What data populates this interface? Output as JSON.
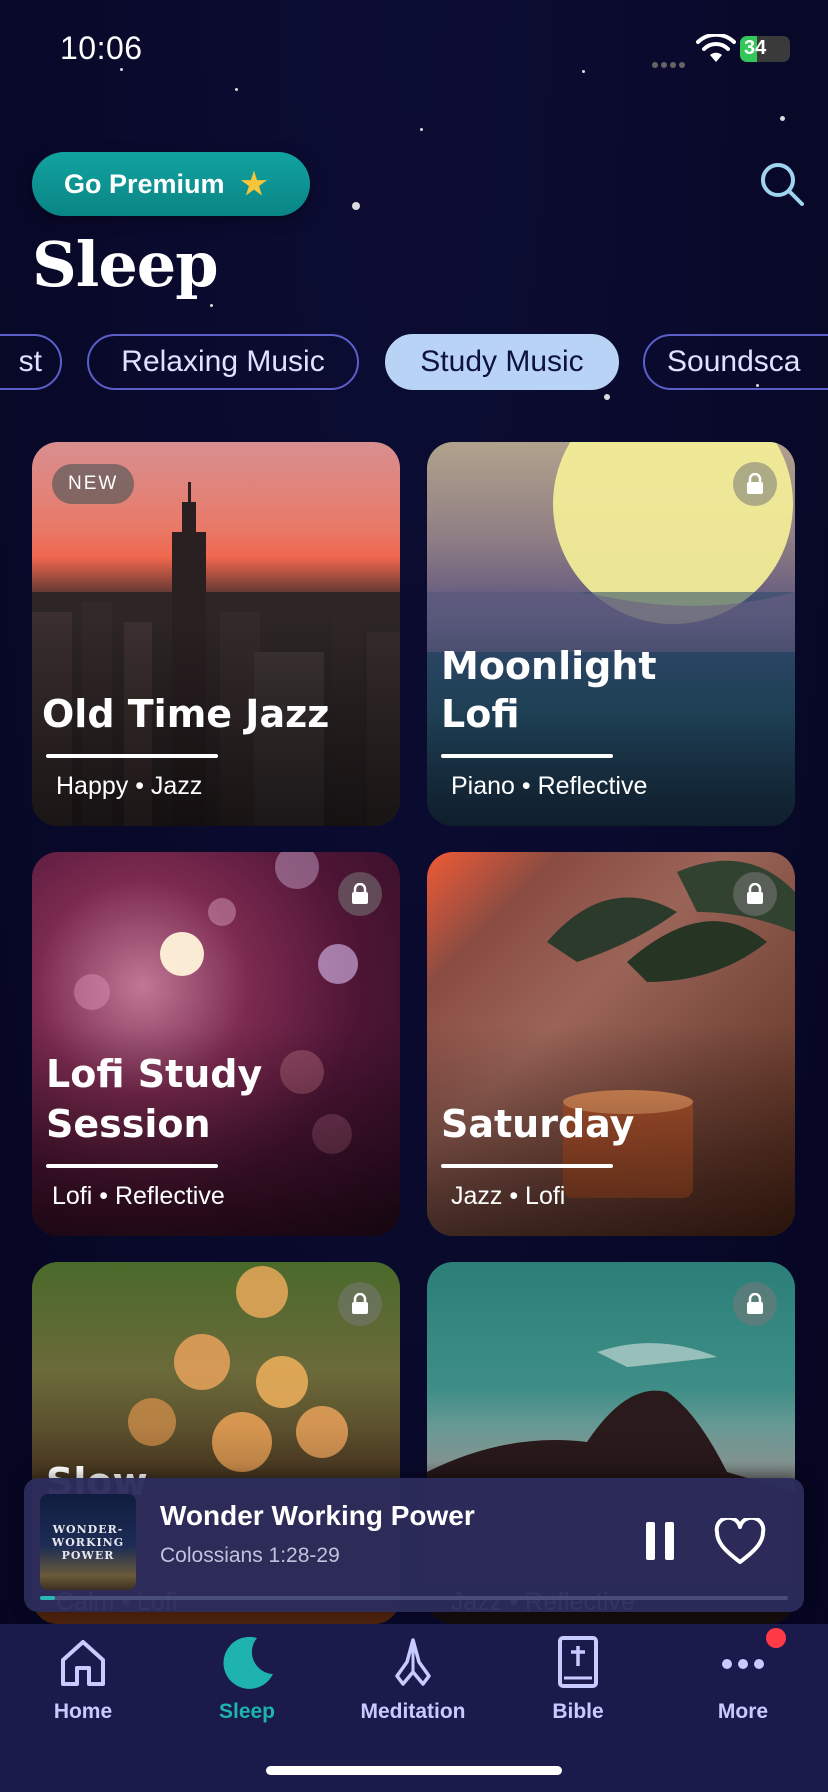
{
  "status": {
    "time": "10:06",
    "battery": "34",
    "battery_level": 0.34
  },
  "header": {
    "premium_label": "Go Premium",
    "page_title": "Sleep"
  },
  "chips": [
    {
      "label": "st"
    },
    {
      "label": "Relaxing Music"
    },
    {
      "label": "Study Music"
    },
    {
      "label": "Soundsca"
    }
  ],
  "active_chip": "Study Music",
  "cards": [
    {
      "title_line1": "Old Time Jazz",
      "title_line2": "",
      "tags": "Happy • Jazz",
      "badge": "NEW",
      "locked": false
    },
    {
      "title_line1": "Moonlight",
      "title_line2": "Lofi",
      "tags": "Piano • Reflective",
      "badge": "",
      "locked": true
    },
    {
      "title_line1": "Lofi Study",
      "title_line2": "Session",
      "tags": "Lofi • Reflective",
      "badge": "",
      "locked": true
    },
    {
      "title_line1": "Saturday",
      "title_line2": "",
      "tags": "Jazz • Lofi",
      "badge": "",
      "locked": true
    },
    {
      "title_line1": "Slow",
      "title_line2": "",
      "tags": "Calm • Lofi",
      "badge": "",
      "locked": true
    },
    {
      "title_line1": "",
      "title_line2": "",
      "tags": "Jazz • Reflective",
      "badge": "",
      "locked": true
    }
  ],
  "player": {
    "title": "Wonder Working Power",
    "subtitle": "Colossians 1:28-29",
    "art_text": [
      "WONDER-",
      "WORKING",
      "POWER"
    ],
    "progress": 0.02
  },
  "tabs": [
    {
      "label": "Home",
      "icon": "house-icon"
    },
    {
      "label": "Sleep",
      "icon": "moon-icon"
    },
    {
      "label": "Meditation",
      "icon": "praying-hands-icon"
    },
    {
      "label": "Bible",
      "icon": "bible-icon"
    },
    {
      "label": "More",
      "icon": "more-dots-icon"
    }
  ],
  "colors": {
    "accent": "#1fb3ad",
    "premium": "#0f9b98",
    "chip_active": "#b9d3f6",
    "background": "#0a0a2e"
  }
}
